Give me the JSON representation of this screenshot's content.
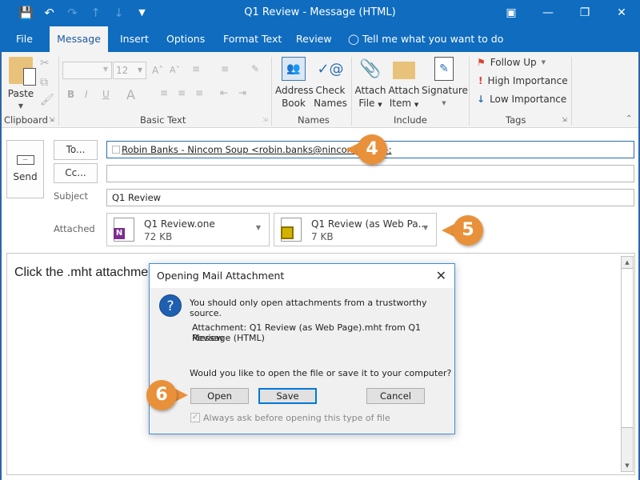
{
  "window": {
    "title": "Q1 Review - Message (HTML)",
    "qat": [
      "save-icon",
      "undo-icon",
      "redo-icon",
      "up-icon",
      "down-icon",
      "customize-icon"
    ],
    "controls": [
      "ribbon-display-icon",
      "minimize-icon",
      "restore-icon",
      "close-icon"
    ]
  },
  "tabs": [
    {
      "label": "File"
    },
    {
      "label": "Message",
      "active": true
    },
    {
      "label": "Insert"
    },
    {
      "label": "Options"
    },
    {
      "label": "Format Text"
    },
    {
      "label": "Review"
    }
  ],
  "tell_me": "Tell me what you want to do",
  "ribbon": {
    "clipboard": {
      "label": "Clipboard",
      "paste": "Paste"
    },
    "basic_text": {
      "label": "Basic Text",
      "font_size": "12",
      "font_name": ""
    },
    "names": {
      "label": "Names",
      "address_book": [
        "Address",
        "Book"
      ],
      "check_names": [
        "Check",
        "Names"
      ]
    },
    "include": {
      "label": "Include",
      "attach_file": [
        "Attach",
        "File"
      ],
      "attach_item": [
        "Attach",
        "Item"
      ],
      "signature": "Signature"
    },
    "tags": {
      "label": "Tags",
      "follow_up": "Follow Up",
      "high": "High Importance",
      "low": "Low Importance"
    }
  },
  "compose": {
    "send": "Send",
    "to_button": "To...",
    "cc_button": "Cc...",
    "to_value": "Robin Banks - Nincom Soup <robin.banks@nincom.soup>;",
    "cc_value": "",
    "subject_label": "Subject",
    "subject_value": "Q1 Review",
    "attached_label": "Attached",
    "attachments": [
      {
        "name": "Q1 Review.one",
        "size": "72 KB",
        "icon": "onenote-icon"
      },
      {
        "name": "Q1 Review (as Web Pa...",
        "size": "7 KB",
        "icon": "web-page-icon"
      }
    ],
    "body_text": "Click the .mht attachme"
  },
  "dialog": {
    "title": "Opening Mail Attachment",
    "warning": "You should only open attachments from a trustworthy source.",
    "attachment_line1": "Attachment: Q1 Review (as Web Page).mht from Q1 Review -",
    "attachment_line2": "Message (HTML)",
    "question": "Would you like to open the file or save it to your computer?",
    "open": "Open",
    "save": "Save",
    "cancel": "Cancel",
    "always_ask": "Always ask before opening this type of file",
    "always_ask_checked": true
  },
  "callouts": [
    "4",
    "5",
    "6"
  ],
  "colors": {
    "accent": "#0f6cbf",
    "callout": "#e8913a"
  }
}
